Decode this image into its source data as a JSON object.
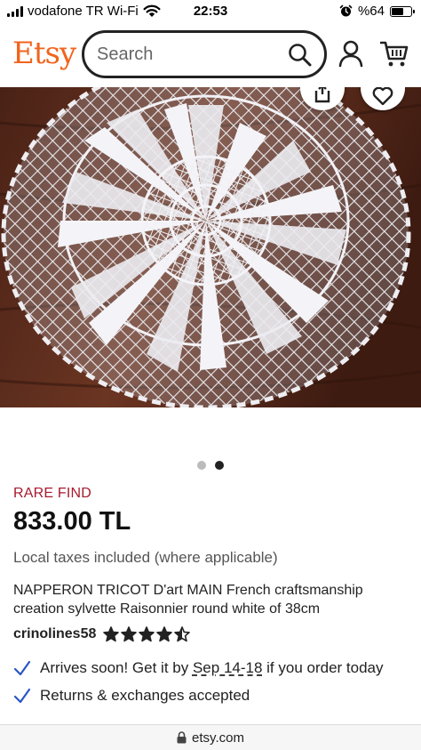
{
  "status_bar": {
    "carrier": "vodafone TR Wi-Fi",
    "time": "22:53",
    "battery": "%64",
    "battery_level": 0.64
  },
  "header": {
    "logo": "Etsy",
    "search_placeholder": "Search",
    "brand_color": "#f1641e"
  },
  "product": {
    "image": "white round crochet doily on dark wood surface",
    "carousel": {
      "total": 2,
      "active_index": 1
    },
    "badge": "RARE FIND",
    "price": "833.00 TL",
    "taxes_note": "Local taxes included (where applicable)",
    "title": "NAPPERON TRICOT D'art MAIN French craftsmanship creation sylvette Raisonnier round white of 38cm",
    "seller": "crinolines58",
    "rating": 4.5
  },
  "perks": {
    "arrival_prefix": "Arrives soon! Get it by",
    "arrival_date": "Sep 14-18",
    "arrival_suffix": "if you order today",
    "returns": "Returns & exchanges accepted"
  },
  "browser": {
    "url": "etsy.com"
  }
}
